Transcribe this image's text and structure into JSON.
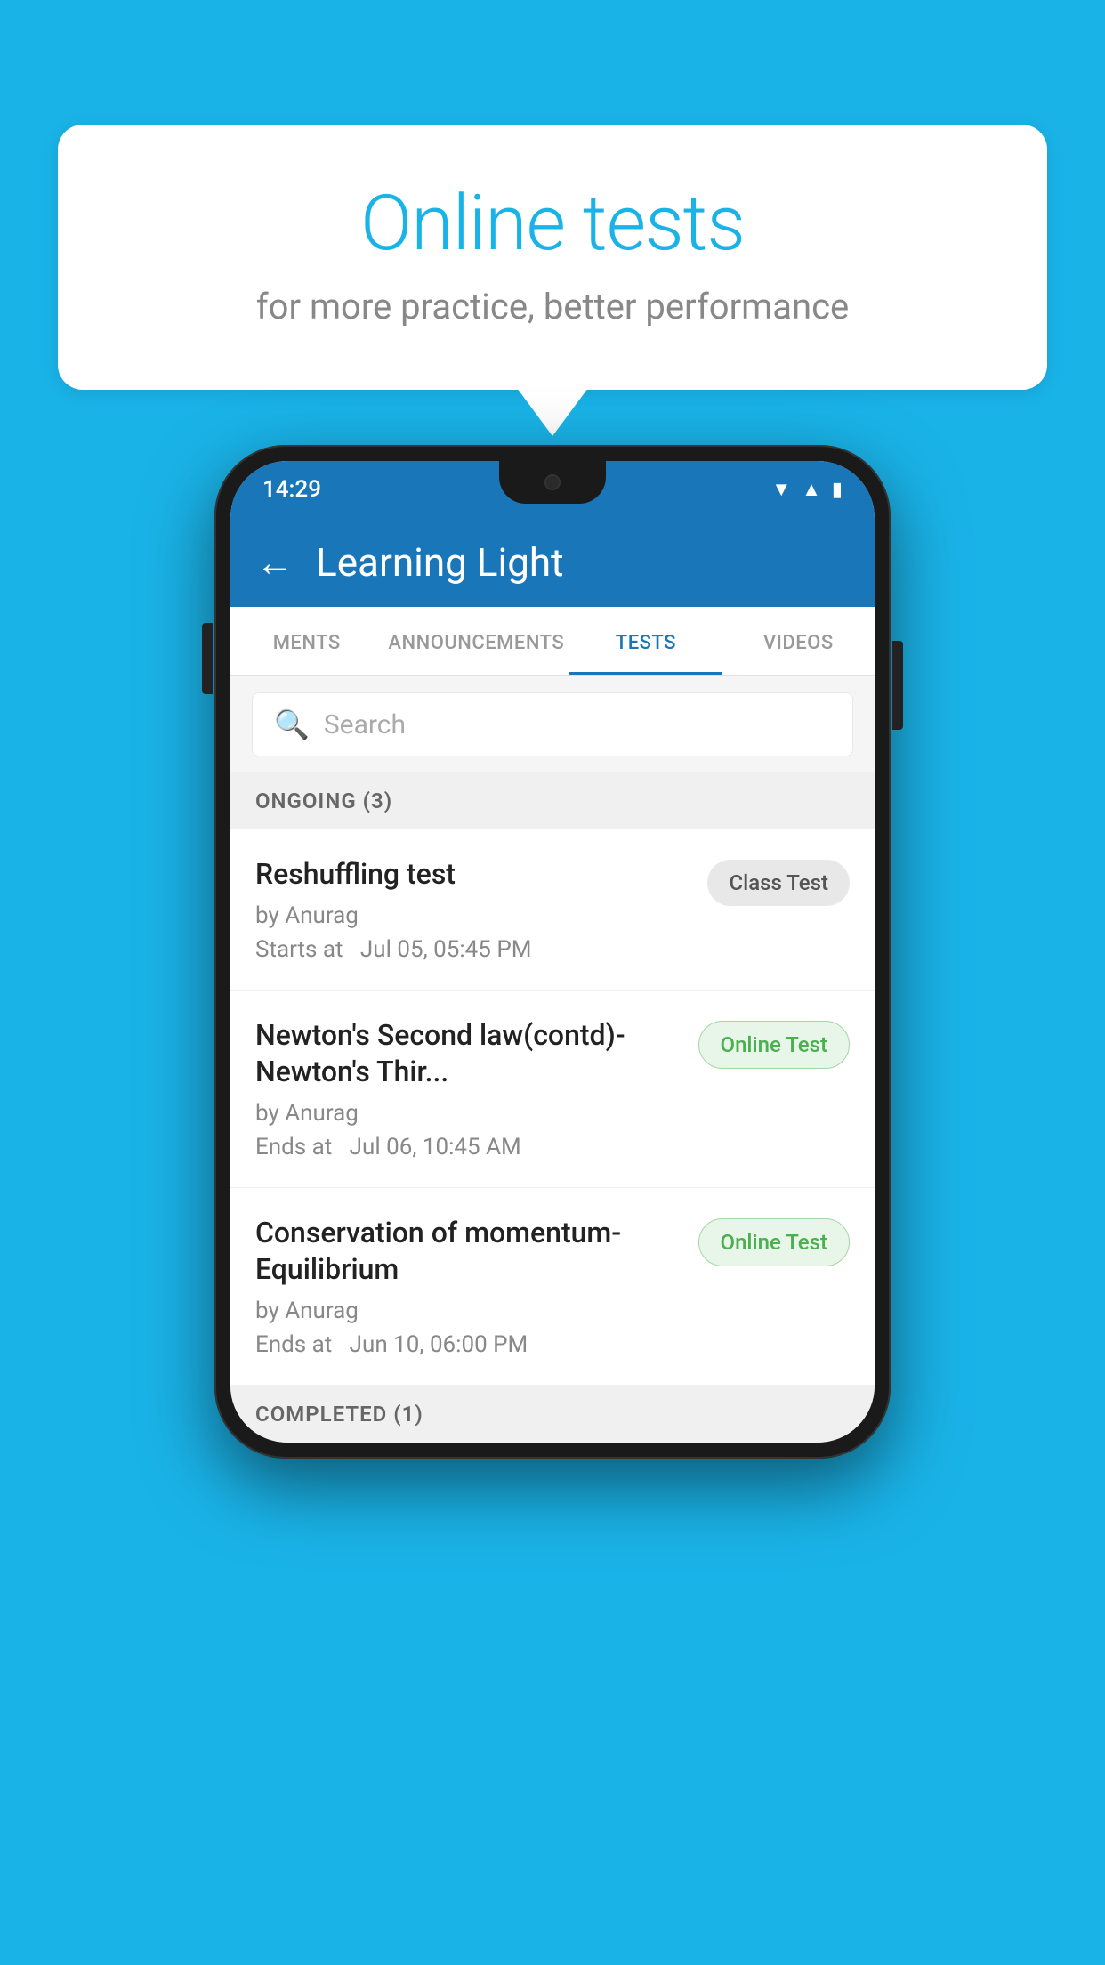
{
  "background_color": "#1ab3e8",
  "speech_bubble": {
    "title": "Online tests",
    "subtitle": "for more practice, better performance"
  },
  "phone": {
    "status_bar": {
      "time": "14:29",
      "icons": [
        "wifi",
        "signal",
        "battery"
      ]
    },
    "app_bar": {
      "back_label": "←",
      "title": "Learning Light"
    },
    "tabs": [
      {
        "label": "MENTS",
        "active": false
      },
      {
        "label": "ANNOUNCEMENTS",
        "active": false
      },
      {
        "label": "TESTS",
        "active": true
      },
      {
        "label": "VIDEOS",
        "active": false
      }
    ],
    "search": {
      "placeholder": "Search"
    },
    "ongoing_section": {
      "label": "ONGOING (3)"
    },
    "test_items": [
      {
        "name": "Reshuffling test",
        "by": "by Anurag",
        "date": "Starts at  Jul 05, 05:45 PM",
        "badge": "Class Test",
        "badge_type": "class"
      },
      {
        "name": "Newton's Second law(contd)-Newton's Thir...",
        "by": "by Anurag",
        "date": "Ends at  Jul 06, 10:45 AM",
        "badge": "Online Test",
        "badge_type": "online"
      },
      {
        "name": "Conservation of momentum-Equilibrium",
        "by": "by Anurag",
        "date": "Ends at  Jun 10, 06:00 PM",
        "badge": "Online Test",
        "badge_type": "online"
      }
    ],
    "completed_section": {
      "label": "COMPLETED (1)"
    }
  }
}
